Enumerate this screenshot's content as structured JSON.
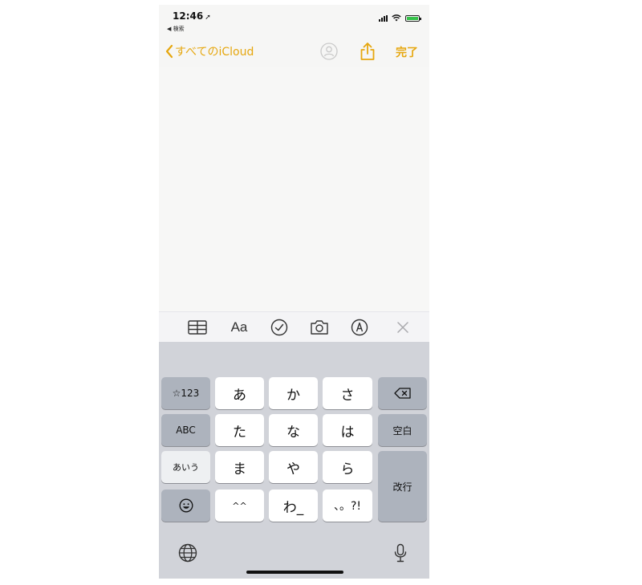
{
  "status_bar": {
    "time": "12:46",
    "back_app": "◀ 検索"
  },
  "navbar": {
    "back_label": "すべてのiCloud",
    "done_label": "完了"
  },
  "toolbar": {
    "text_format_label": "Aa"
  },
  "keyboard": {
    "row1": [
      "☆123",
      "あ",
      "か",
      "さ"
    ],
    "row2": [
      "ABC",
      "た",
      "な",
      "は",
      "空白"
    ],
    "row3": [
      "あいう",
      "ま",
      "や",
      "ら",
      "改行"
    ],
    "row4": [
      "^^",
      "わ_",
      "、。?!"
    ]
  },
  "colors": {
    "accent": "#e6a70f",
    "note_bg": "#f7f7f6",
    "keyboard_bg": "#d1d3d9"
  }
}
